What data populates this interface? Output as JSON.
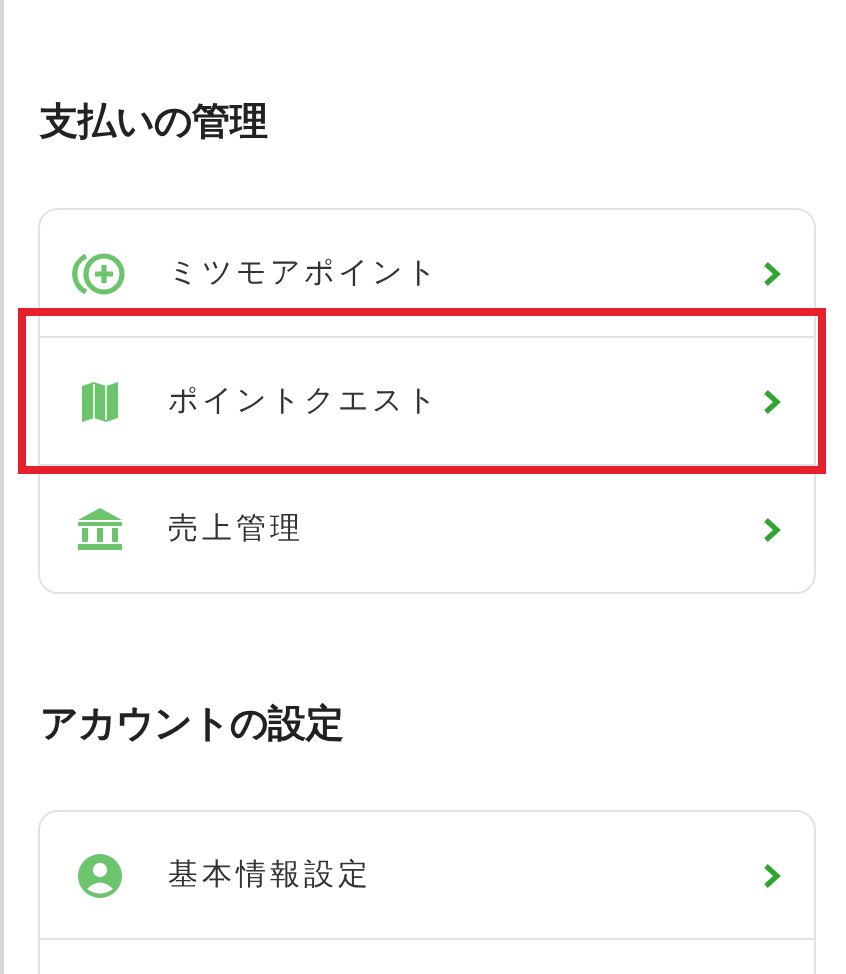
{
  "sections": [
    {
      "title": "支払いの管理",
      "items": [
        {
          "kind": "points",
          "label": "ミツモアポイント",
          "highlighted": false
        },
        {
          "kind": "map",
          "label": "ポイントクエスト",
          "highlighted": true
        },
        {
          "kind": "bank",
          "label": "売上管理",
          "highlighted": false
        }
      ]
    },
    {
      "title": "アカウントの設定",
      "items": [
        {
          "kind": "user",
          "label": "基本情報設定",
          "highlighted": false
        }
      ]
    }
  ]
}
